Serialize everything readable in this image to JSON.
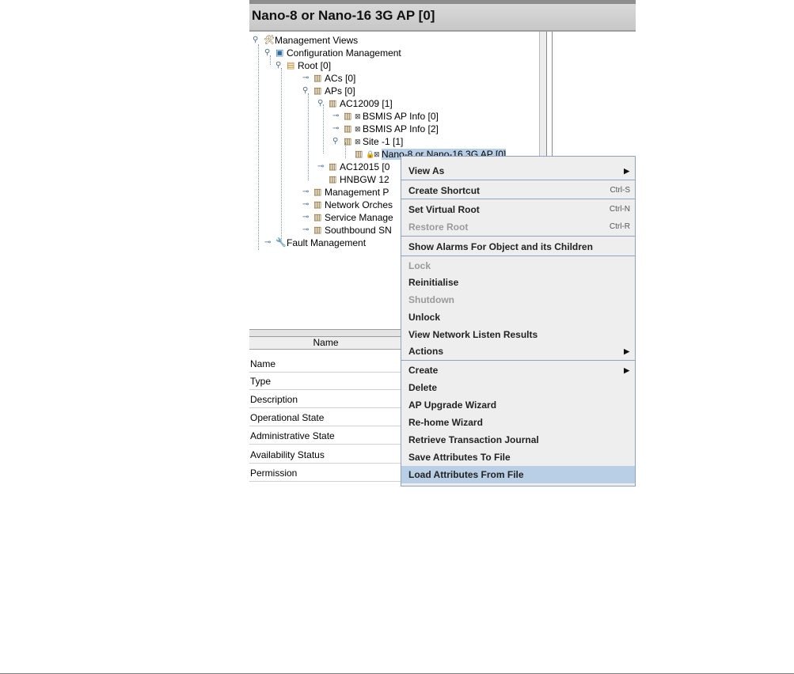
{
  "window": {
    "title": "Nano-8 or Nano-16 3G AP [0]"
  },
  "tree": {
    "management_views": "Management Views",
    "configuration_management": "Configuration Management",
    "root": "Root [0]",
    "acs": "ACs [0]",
    "aps": "APs [0]",
    "ac12009": "AC12009 [1]",
    "bsmis_0": "BSMIS AP Info [0]",
    "bsmis_2": "BSMIS AP Info [2]",
    "site": "Site -1 [1]",
    "nano": "Nano-8 or Nano-16 3G AP [0]",
    "ac12015": "AC12015 [0",
    "hnbgw": "HNBGW 12",
    "management_p": "Management P",
    "network_orches": "Network Orches",
    "service_manage": "Service Manage",
    "southbound": "Southbound SN",
    "fault_management": "Fault Management"
  },
  "attributes": {
    "header": "Name",
    "rows": [
      "Name",
      "Type",
      "Description",
      "Operational State",
      "Administrative State",
      "Availability Status",
      "Permission"
    ]
  },
  "context_menu": {
    "view_as": "View As",
    "create_shortcut": "Create Shortcut",
    "create_shortcut_key": "Ctrl-S",
    "set_virtual_root": "Set Virtual Root",
    "set_virtual_root_key": "Ctrl-N",
    "restore_root": "Restore Root",
    "restore_root_key": "Ctrl-R",
    "show_alarms": "Show Alarms For Object and its Children",
    "lock": "Lock",
    "reinitialise": "Reinitialise",
    "shutdown": "Shutdown",
    "unlock": "Unlock",
    "view_network_listen": "View Network Listen Results",
    "actions": "Actions",
    "create": "Create",
    "delete": "Delete",
    "ap_upgrade_wizard": "AP Upgrade Wizard",
    "rehome_wizard": "Re-home Wizard",
    "retrieve_transaction_journal": "Retrieve Transaction Journal",
    "save_attributes": "Save Attributes To File",
    "load_attributes": "Load Attributes From File"
  },
  "colors": {
    "selection": "#b8cfe5",
    "menu_border": "#8da3c0",
    "title_bar": "#c7c7c7"
  },
  "icons": {
    "expanded": "expanded-toggle-icon",
    "collapsed": "collapsed-toggle-icon",
    "tools": "tools-icon",
    "config": "config-icon",
    "folder": "folder-icon",
    "node": "managed-object-icon",
    "lock": "lock-icon",
    "alarm_mark": "alarm-mark-icon",
    "fault": "fault-management-icon",
    "submenu_arrow": "submenu-arrow-icon"
  }
}
